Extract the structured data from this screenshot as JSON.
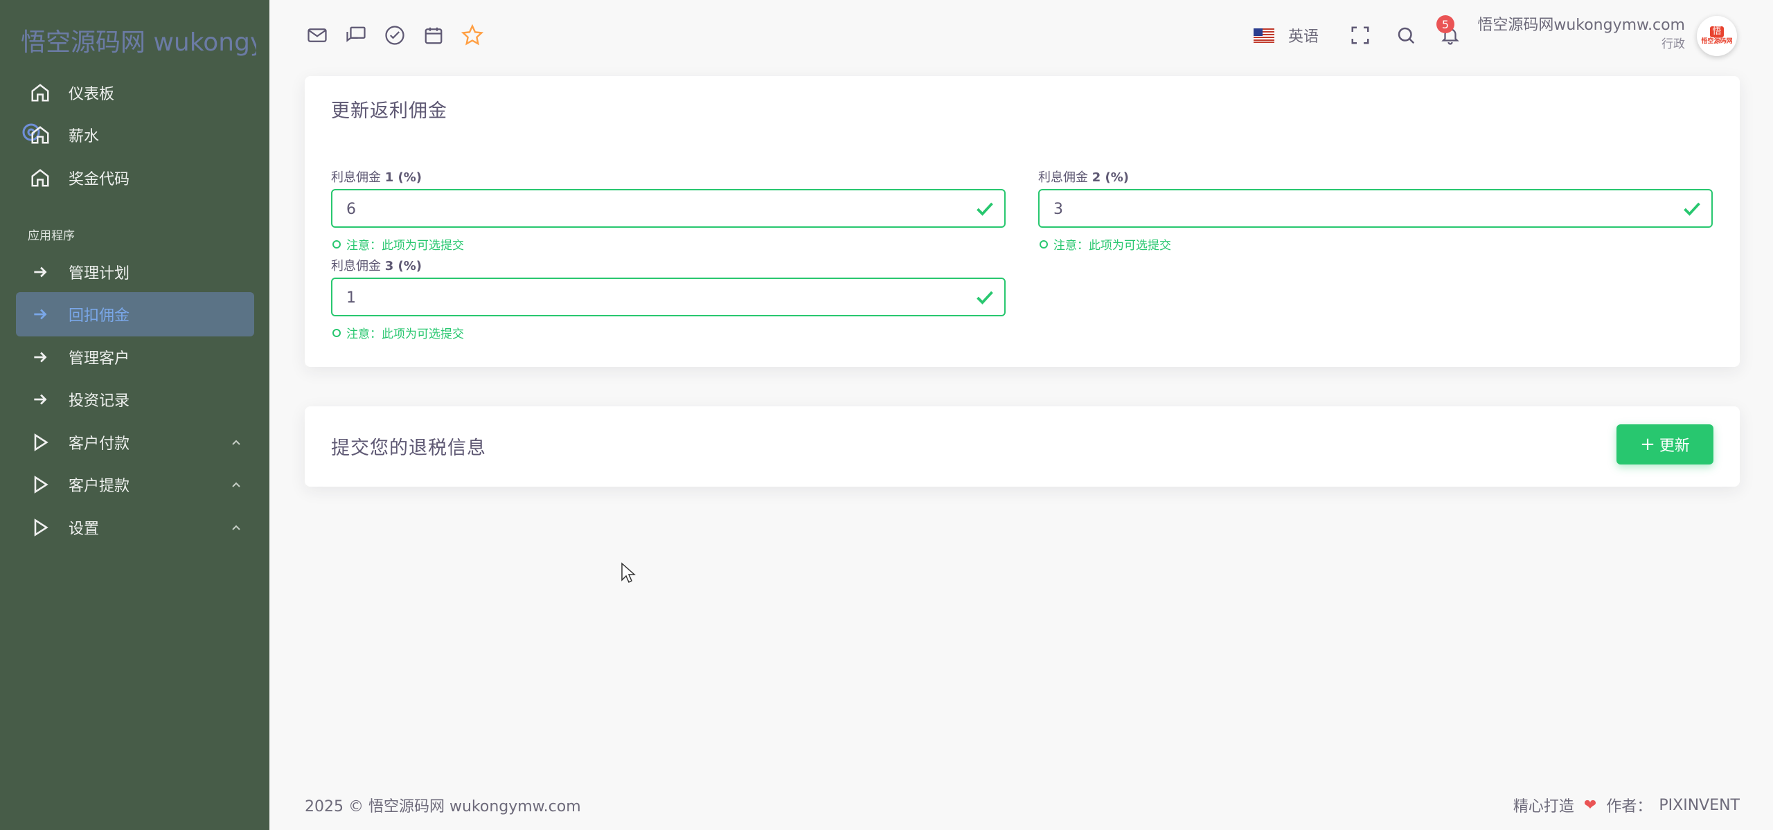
{
  "sidebar": {
    "brand": "悟空源码网 wukongymw.com",
    "items": [
      {
        "label": "仪表板",
        "icon": "home-icon"
      },
      {
        "label": "薪水",
        "icon": "home-icon"
      },
      {
        "label": "奖金代码",
        "icon": "home-icon"
      }
    ],
    "section_label": "应用程序",
    "app_items": [
      {
        "label": "管理计划",
        "icon": "arrow-right-icon"
      },
      {
        "label": "回扣佣金",
        "icon": "arrow-right-icon",
        "active": true
      },
      {
        "label": "管理客户",
        "icon": "arrow-right-icon"
      },
      {
        "label": "投资记录",
        "icon": "arrow-right-icon"
      },
      {
        "label": "客户付款",
        "icon": "play-icon",
        "expandable": true
      },
      {
        "label": "客户提款",
        "icon": "play-icon",
        "expandable": true
      },
      {
        "label": "设置",
        "icon": "play-icon",
        "expandable": true
      }
    ]
  },
  "topbar": {
    "language": "英语",
    "notification_count": "5",
    "user_name": "悟空源码网wukongymw.com",
    "user_role": "行政",
    "avatar_text_top": "悟",
    "avatar_text_bottom": "悟空源码网",
    "icons": [
      "mail-icon",
      "chat-icon",
      "check-circle-icon",
      "calendar-icon",
      "star-icon",
      "fullscreen-icon",
      "search-icon",
      "bell-icon"
    ],
    "accent_star": "#ff9f43"
  },
  "card1": {
    "title": "更新返利佣金",
    "fields": [
      {
        "label_prefix": "利息佣金 ",
        "label_num": "1",
        "label_suffix": " (%)",
        "value": "6",
        "hint": "注意：此项为可选提交"
      },
      {
        "label_prefix": "利息佣金 ",
        "label_num": "2",
        "label_suffix": " (%)",
        "value": "3",
        "hint": "注意：此项为可选提交"
      },
      {
        "label_prefix": "利息佣金 ",
        "label_num": "3",
        "label_suffix": " (%)",
        "value": "1",
        "hint": "注意：此项为可选提交"
      }
    ]
  },
  "card2": {
    "title": "提交您的退税信息",
    "button_label": "更新"
  },
  "footer": {
    "copyright": "2025 © 悟空源码网 wukongymw.com",
    "made_with": "精心打造",
    "author_label": "作者：",
    "author": "PIXINVENT"
  },
  "colors": {
    "sidebar_bg": "#475c48",
    "success": "#28c76f",
    "danger": "#ea5455",
    "active_bg": "#5b7386"
  }
}
